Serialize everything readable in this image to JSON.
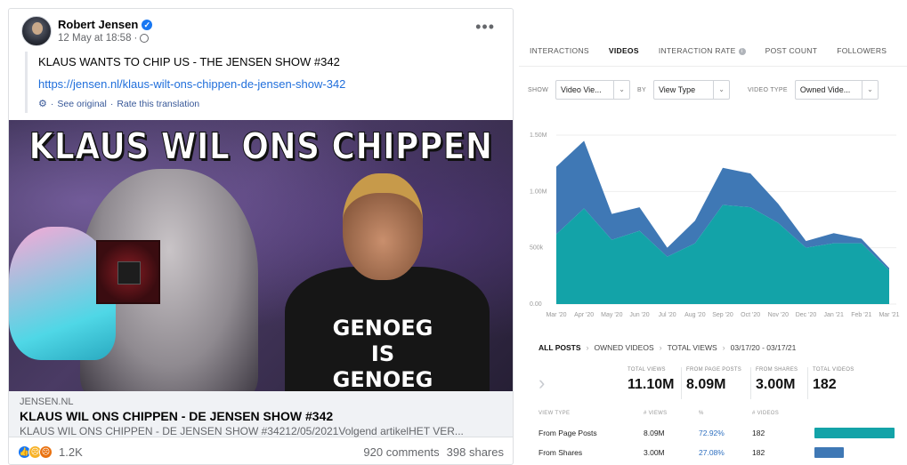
{
  "post": {
    "author": "Robert Jensen",
    "timestamp": "12 May at 18:58",
    "more_icon": "ellipsis-icon",
    "title": "KLAUS WANTS TO CHIP US - THE JENSEN SHOW #342",
    "link": "https://jensen.nl/klaus-wilt-ons-chippen-de-jensen-show-342",
    "see_original": "See original",
    "separator": "·",
    "rate_translation": "Rate this translation",
    "thumbnail": {
      "headline": "KLAUS WIL ONS CHIPPEN",
      "shirt_line1": "GENOEG",
      "shirt_line2": "IS",
      "shirt_line3": "GENOEG"
    },
    "card": {
      "domain": "JENSEN.NL",
      "title": "KLAUS WIL ONS CHIPPEN - DE JENSEN SHOW #342",
      "description": "KLAUS WIL ONS CHIPPEN - DE JENSEN SHOW #34212/05/2021Volgend artikelHET VER..."
    },
    "reaction_count": "1.2K",
    "comments": "920 comments",
    "shares": "398 shares"
  },
  "analytics": {
    "tabs": [
      "INTERACTIONS",
      "VIDEOS",
      "INTERACTION RATE",
      "POST COUNT",
      "FOLLOWERS"
    ],
    "active_tab": "VIDEOS",
    "filters": {
      "show_label": "SHOW",
      "show_value": "Video Vie...",
      "by_label": "BY",
      "by_value": "View Type",
      "video_type_label": "VIDEO TYPE",
      "video_type_value": "Owned Vide..."
    },
    "breadcrumb": [
      "ALL POSTS",
      "OWNED VIDEOS",
      "TOTAL VIEWS",
      "03/17/20 - 03/17/21"
    ],
    "metrics": [
      {
        "label": "TOTAL VIEWS",
        "value": "11.10M"
      },
      {
        "label": "FROM PAGE POSTS",
        "value": "8.09M"
      },
      {
        "label": "FROM SHARES",
        "value": "3.00M"
      },
      {
        "label": "TOTAL VIDEOS",
        "value": "182"
      }
    ],
    "table": {
      "headers": [
        "VIEW TYPE",
        "# VIEWS",
        "%",
        "# VIDEOS",
        ""
      ],
      "rows": [
        {
          "type": "From Page Posts",
          "views": "8.09M",
          "pct": "72.92%",
          "videos": "182",
          "fraction": 0.7292,
          "color": "#13a3a8"
        },
        {
          "type": "From Shares",
          "views": "3.00M",
          "pct": "27.08%",
          "videos": "182",
          "fraction": 0.2708,
          "color": "#3f78b5"
        }
      ]
    }
  },
  "chart_data": {
    "type": "area",
    "stacked": true,
    "categories": [
      "Mar '20",
      "Apr '20",
      "May '20",
      "Jun '20",
      "Jul '20",
      "Aug '20",
      "Sep '20",
      "Oct '20",
      "Nov '20",
      "Dec '20",
      "Jan '21",
      "Feb '21",
      "Mar '21"
    ],
    "y_ticks": [
      "0.00",
      "500k",
      "1.00M",
      "1.50M"
    ],
    "ylim": [
      0,
      1500000
    ],
    "series": [
      {
        "name": "From Page Posts",
        "color": "#13a3a8",
        "values": [
          620000,
          850000,
          570000,
          650000,
          420000,
          540000,
          880000,
          860000,
          720000,
          500000,
          540000,
          540000,
          300000
        ]
      },
      {
        "name": "From Shares",
        "color": "#3f78b5",
        "values": [
          600000,
          600000,
          230000,
          210000,
          80000,
          200000,
          330000,
          300000,
          170000,
          60000,
          90000,
          40000,
          20000
        ]
      }
    ],
    "grid": true
  }
}
